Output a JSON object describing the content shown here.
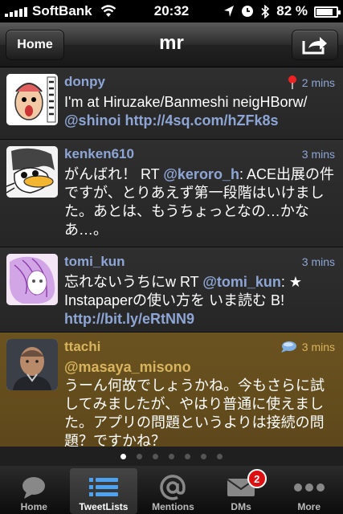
{
  "status_bar": {
    "carrier": "SoftBank",
    "time": "20:32",
    "battery": "82 %",
    "battery_level": 0.82
  },
  "navbar": {
    "home_label": "Home",
    "title": "mr"
  },
  "tweets": [
    {
      "user": "donpy",
      "time": "2 mins",
      "text": "I'm at Hiruzake/Banmeshi neigHBorw/ ",
      "link": "@shinoi http://4sq.com/hZFk8s"
    },
    {
      "user": "kenken610",
      "time": "3 mins",
      "text": "がんばれ！ RT ",
      "link": "@keroro_h",
      "text2": ": ACE出展の件ですが、とりあえず第一段階はいけました。あとは、もうちょっとなの…かなあ…。"
    },
    {
      "user": "tomi_kun",
      "time": "3 mins",
      "text": "忘れないうちにw RT ",
      "link": "@tomi_kun",
      "text2": ": ★ Instapaperの使い方を いま読む B! ",
      "link2": "http://bit.ly/eRtNN9"
    },
    {
      "user": "ttachi",
      "time": "3 mins",
      "link": "@masaya_misono",
      "text": "うーん何故でしょうかね。今もさらに試してみましたが、やはり普通に使えました。アプリの問題というよりは接続の問題？ですかね？"
    }
  ],
  "page_dots": {
    "count": 7,
    "active": 0
  },
  "tabbar": {
    "tabs": [
      {
        "label": "Home",
        "icon": "speech-bubble-icon"
      },
      {
        "label": "TweetLists",
        "icon": "list-icon"
      },
      {
        "label": "Mentions",
        "icon": "at-sign-icon"
      },
      {
        "label": "DMs",
        "icon": "envelope-icon",
        "badge": "2"
      },
      {
        "label": "More",
        "icon": "more-dots-icon"
      }
    ],
    "active": 1
  },
  "colors": {
    "link": "#8ea6d6",
    "highlight_bg": "#6b5320",
    "highlight_text": "#d9b45e",
    "badge": "#dd1111"
  }
}
